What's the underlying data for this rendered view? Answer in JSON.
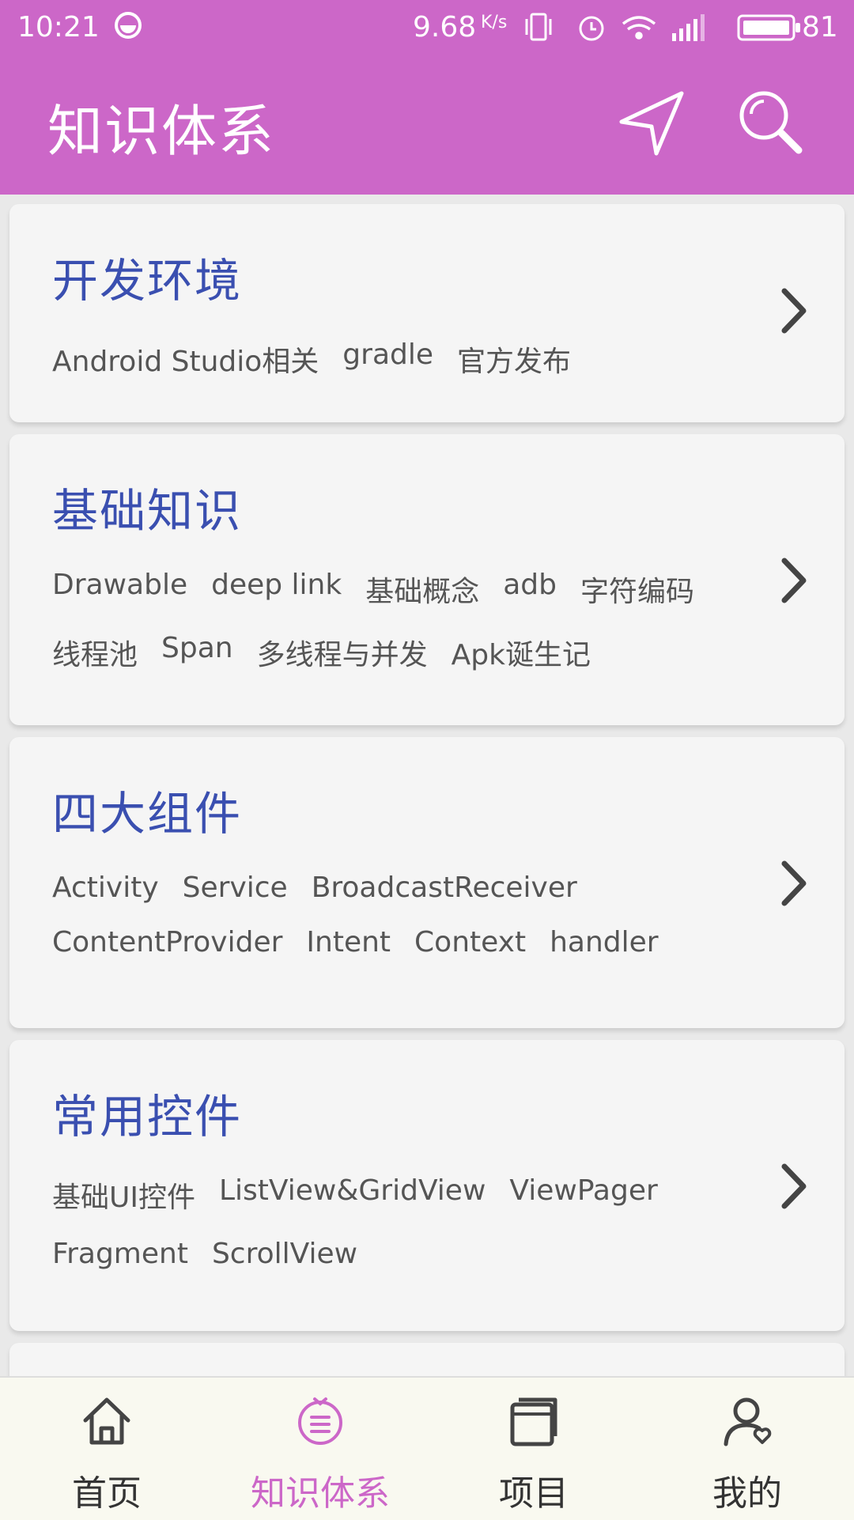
{
  "status_bar": {
    "time": "10:21",
    "net_speed": "9.68",
    "net_unit": "K/s",
    "battery": "81"
  },
  "app_bar": {
    "title": "知识体系",
    "nav_icon": "navigation-arrow-icon",
    "search_icon": "search-icon"
  },
  "categories": [
    {
      "title": "开发环境",
      "tags": [
        "Android Studio相关",
        "gradle",
        "官方发布"
      ]
    },
    {
      "title": "基础知识",
      "tags": [
        "Drawable",
        "deep link",
        "基础概念",
        "adb",
        "字符编码",
        "线程池",
        "Span",
        "多线程与并发",
        "Apk诞生记"
      ]
    },
    {
      "title": "四大组件",
      "tags": [
        "Activity",
        "Service",
        "BroadcastReceiver",
        "ContentProvider",
        "Intent",
        "Context",
        "handler"
      ]
    },
    {
      "title": "常用控件",
      "tags": [
        "基础UI控件",
        "ListView&GridView",
        "ViewPager",
        "Fragment",
        "ScrollView"
      ]
    }
  ],
  "bottom_nav": [
    {
      "label": "首页",
      "icon": "home-icon",
      "active": false
    },
    {
      "label": "知识体系",
      "icon": "knowledge-list-icon",
      "active": true
    },
    {
      "label": "项目",
      "icon": "project-icon",
      "active": false
    },
    {
      "label": "我的",
      "icon": "profile-icon",
      "active": false
    }
  ],
  "colors": {
    "accent": "#cc67c8",
    "category_title": "#3a4fb0",
    "card_background": "#f5f5f5"
  }
}
